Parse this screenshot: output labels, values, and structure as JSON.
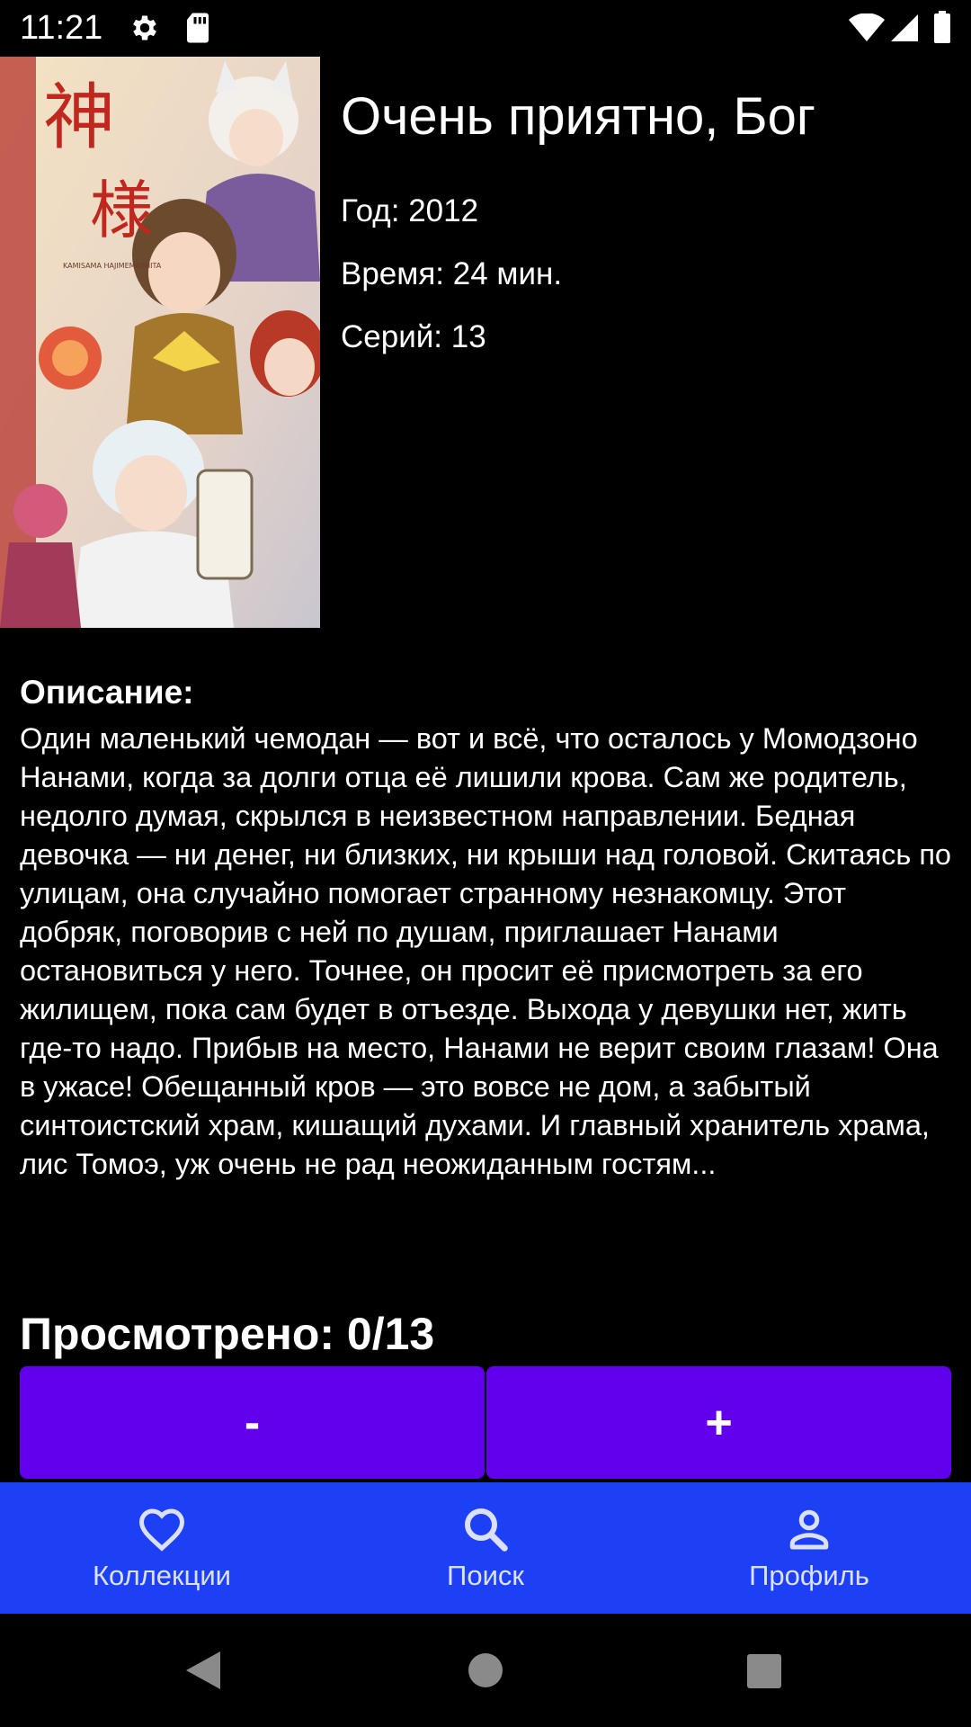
{
  "status_bar": {
    "time": "11:21",
    "left_icons": [
      "gear-icon",
      "sd-card-icon"
    ],
    "right_icons": [
      "wifi-icon",
      "signal-icon",
      "battery-icon"
    ]
  },
  "anime": {
    "title": "Очень приятно, Бог",
    "year_label": "Год: ",
    "year": "2012",
    "duration_label": "Время: ",
    "duration": "24 мин.",
    "episodes_label": "Серий: ",
    "episodes": "13",
    "poster_text": [
      "神",
      "様",
      "KAMISAMA HAJIMEMASHITA"
    ]
  },
  "description": {
    "label": "Описание:",
    "text": "Один маленький чемодан — вот и всё, что осталось у Момодзоно Нанами, когда за долги отца её лишили крова. Сам же родитель, недолго думая, скрылся в неизвестном направлении. Бедная девочка — ни денег, ни близких, ни крыши над головой. Скитаясь по улицам, она случайно помогает странному незнакомцу. Этот добряк, поговорив с ней по душам, приглашает Нанами остановиться у него. Точнее, он просит её присмотреть за его жилищем, пока сам будет в отъезде. Выхода у девушки нет, жить где-то надо. Прибыв на место, Нанами не верит своим глазам! Она в ужасе! Обещанный кров — это вовсе не дом, а забытый синтоистский храм, кишащий духами. И главный хранитель храма, лис Томоэ, уж очень не рад неожиданным гостям..."
  },
  "progress": {
    "label": "Просмотрено: ",
    "watched": 0,
    "total": 13,
    "text": "0/13",
    "minus_label": "-",
    "plus_label": "+"
  },
  "bottom_nav": {
    "items": [
      {
        "label": "Коллекции",
        "icon": "heart-icon"
      },
      {
        "label": "Поиск",
        "icon": "search-icon"
      },
      {
        "label": "Профиль",
        "icon": "person-icon"
      }
    ]
  },
  "system_nav": [
    "back-icon",
    "home-icon",
    "recents-icon"
  ],
  "colors": {
    "background": "#000000",
    "button": "#6200ee",
    "bottom_nav": "#1e40f5",
    "text": "#ffffff"
  }
}
